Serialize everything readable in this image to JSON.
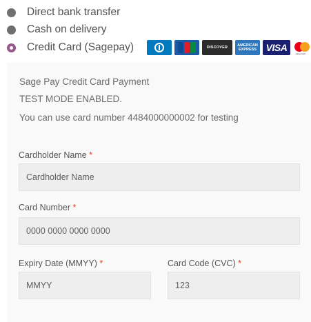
{
  "payment_methods": [
    {
      "label": "Direct bank transfer",
      "selected": false
    },
    {
      "label": "Cash on delivery",
      "selected": false
    },
    {
      "label": "Credit Card (Sagepay)",
      "selected": true
    }
  ],
  "card_icons": [
    "diners-club-icon",
    "jcb-icon",
    "discover-icon",
    "amex-icon",
    "visa-icon",
    "mastercard-icon"
  ],
  "card_icon_text": {
    "discover": "DISCOVER",
    "amex_line1": "AMERICAN",
    "amex_line2": "EXPRESS",
    "visa": "VISA",
    "mastercard": "mastercard"
  },
  "info": {
    "title": "Sage Pay Credit Card Payment",
    "test_mode": "TEST MODE ENABLED.",
    "test_card_note": "You can use card number 4484000000002 for testing"
  },
  "fields": {
    "cardholder_name": {
      "label": "Cardholder Name",
      "placeholder": "Cardholder Name"
    },
    "card_number": {
      "label": "Card Number",
      "placeholder": "0000 0000 0000 0000"
    },
    "expiry": {
      "label": "Expiry Date (MMYY)",
      "placeholder": "MMYY"
    },
    "cvc": {
      "label": "Card Code (CVC)",
      "placeholder": "123"
    },
    "required_mark": "*"
  },
  "colors": {
    "selected_radio": "#96588a",
    "required": "#e2401c",
    "panel_bg": "#f9f9f9"
  }
}
